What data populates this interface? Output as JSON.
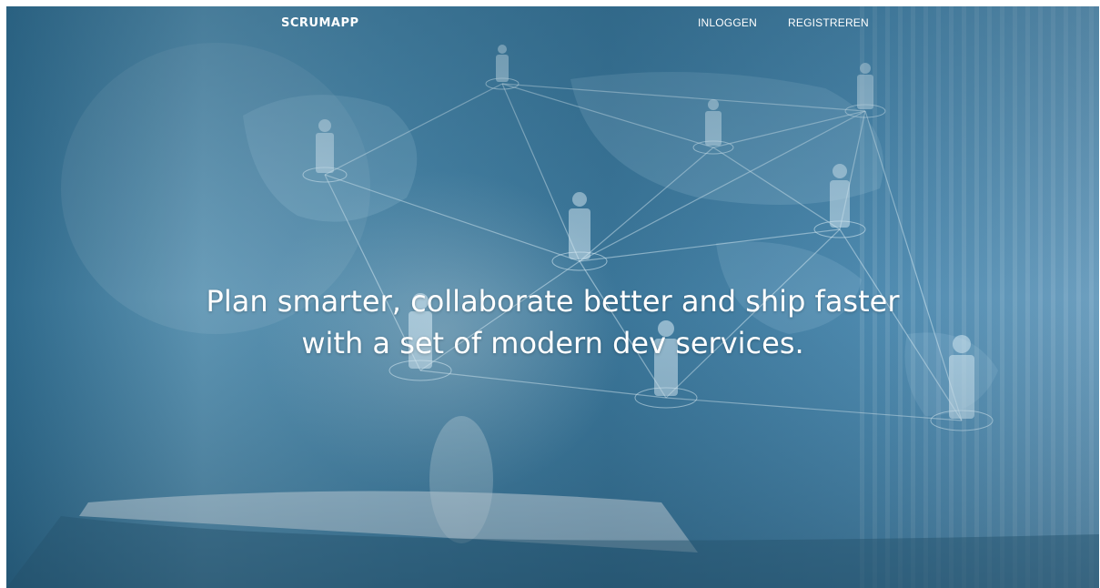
{
  "header": {
    "brand": "SCRUMAPP",
    "nav": [
      {
        "label": "INLOGGEN"
      },
      {
        "label": "REGISTREREN"
      }
    ]
  },
  "hero": {
    "headline_line1": "Plan smarter, collaborate better and ship faster",
    "headline_line2": "with a set of modern dev services."
  },
  "colors": {
    "overlay": "#3e7da0",
    "text": "#ffffff"
  }
}
